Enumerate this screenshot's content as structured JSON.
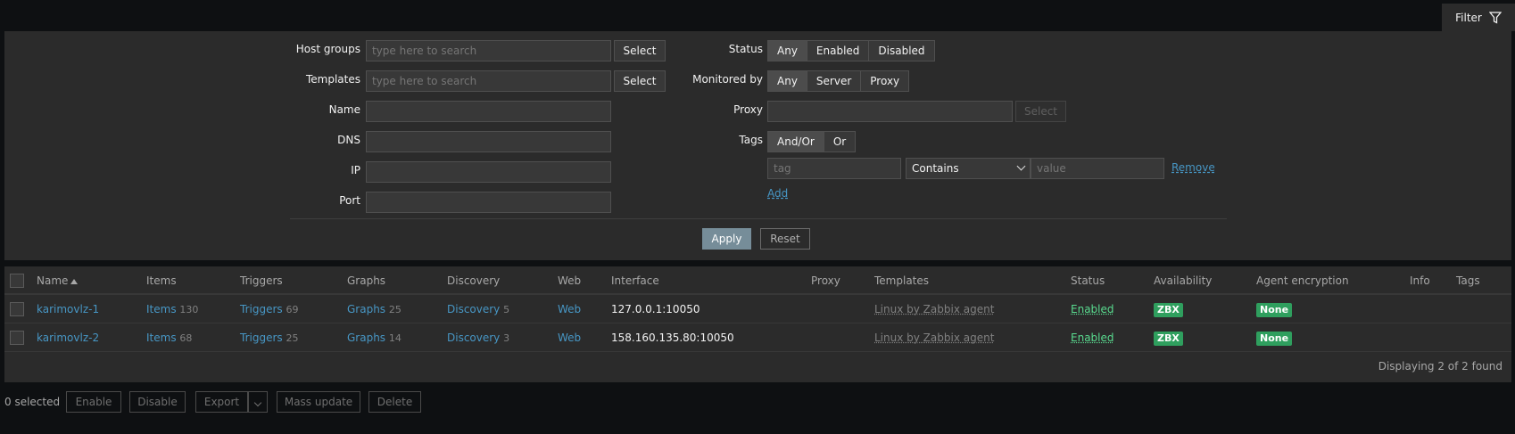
{
  "filter_tab": {
    "label": "Filter",
    "icon": "funnel-icon"
  },
  "filter": {
    "host_groups": {
      "label": "Host groups",
      "placeholder": "type here to search",
      "button": "Select"
    },
    "templates": {
      "label": "Templates",
      "placeholder": "type here to search",
      "button": "Select"
    },
    "name": {
      "label": "Name",
      "value": ""
    },
    "dns": {
      "label": "DNS",
      "value": ""
    },
    "ip": {
      "label": "IP",
      "value": ""
    },
    "port": {
      "label": "Port",
      "value": ""
    },
    "status": {
      "label": "Status",
      "options": [
        "Any",
        "Enabled",
        "Disabled"
      ],
      "selected": "Any"
    },
    "monitored_by": {
      "label": "Monitored by",
      "options": [
        "Any",
        "Server",
        "Proxy"
      ],
      "selected": "Any"
    },
    "proxy": {
      "label": "Proxy",
      "value": "",
      "button": "Select"
    },
    "tags": {
      "label": "Tags",
      "options": [
        "And/Or",
        "Or"
      ],
      "selected": "And/Or",
      "row": {
        "tag_placeholder": "tag",
        "operator": "Contains",
        "value_placeholder": "value",
        "remove": "Remove"
      },
      "add": "Add"
    },
    "apply": "Apply",
    "reset": "Reset"
  },
  "table": {
    "headers": {
      "name": "Name",
      "items": "Items",
      "triggers": "Triggers",
      "graphs": "Graphs",
      "discovery": "Discovery",
      "web": "Web",
      "interface": "Interface",
      "proxy": "Proxy",
      "templates": "Templates",
      "status": "Status",
      "availability": "Availability",
      "agent_encryption": "Agent encryption",
      "info": "Info",
      "tags": "Tags"
    },
    "rows": [
      {
        "name": "karimovlz-1",
        "items_label": "Items",
        "items_count": "130",
        "triggers_label": "Triggers",
        "triggers_count": "69",
        "graphs_label": "Graphs",
        "graphs_count": "25",
        "discovery_label": "Discovery",
        "discovery_count": "5",
        "web": "Web",
        "interface": "127.0.0.1:10050",
        "templates": "Linux by Zabbix agent",
        "status": "Enabled",
        "availability": "ZBX",
        "encryption": "None"
      },
      {
        "name": "karimovlz-2",
        "items_label": "Items",
        "items_count": "68",
        "triggers_label": "Triggers",
        "triggers_count": "25",
        "graphs_label": "Graphs",
        "graphs_count": "14",
        "discovery_label": "Discovery",
        "discovery_count": "3",
        "web": "Web",
        "interface": "158.160.135.80:10050",
        "templates": "Linux by Zabbix agent",
        "status": "Enabled",
        "availability": "ZBX",
        "encryption": "None"
      }
    ],
    "footer": "Displaying 2 of 2 found"
  },
  "actions": {
    "selected": "0 selected",
    "enable": "Enable",
    "disable": "Disable",
    "export": "Export",
    "mass_update": "Mass update",
    "delete": "Delete"
  },
  "colors": {
    "link": "#4796c4",
    "enabled": "#59db8f",
    "badge": "#2f9f5e",
    "apply": "#768d99"
  }
}
